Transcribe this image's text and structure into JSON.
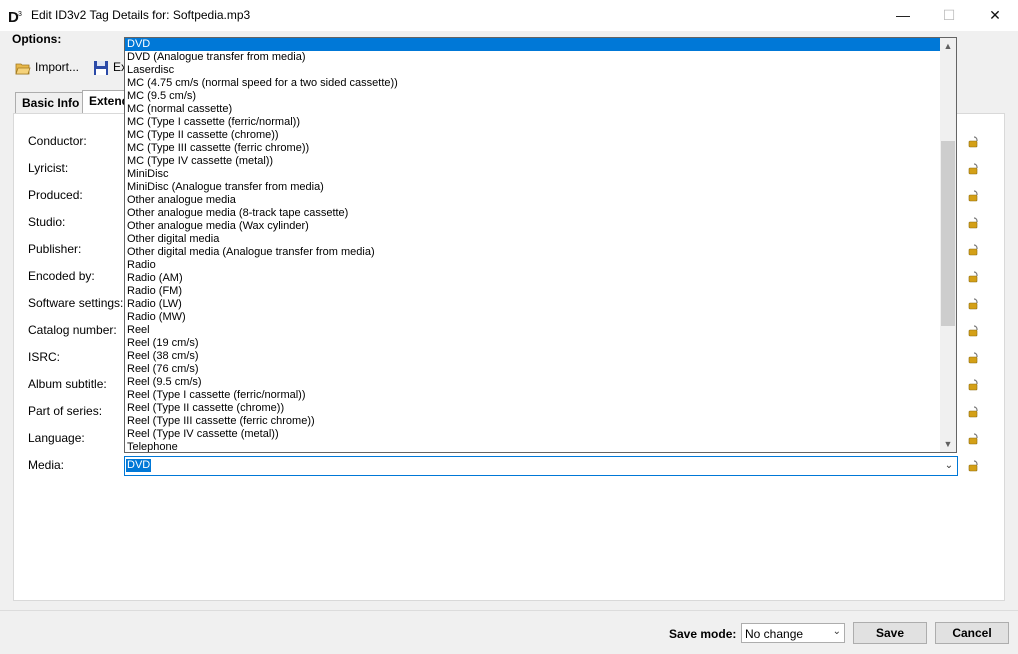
{
  "window": {
    "title": "Edit ID3v2 Tag Details for: Softpedia.mp3",
    "controls": {
      "minimize": "—",
      "maximize": "☐",
      "close": "✕"
    }
  },
  "options_label": "Options:",
  "toolbar": {
    "import_label": "Import...",
    "export_label": "Ex"
  },
  "tabs": [
    {
      "label": "Basic Info",
      "active": false
    },
    {
      "label": "Extende",
      "active": true
    }
  ],
  "fields": [
    "Conductor:",
    "Lyricist:",
    "Produced:",
    "Studio:",
    "Publisher:",
    "Encoded by:",
    "Software settings:",
    "Catalog number:",
    "ISRC:",
    "Album subtitle:",
    "Part of series:",
    "Language:",
    "Media:"
  ],
  "media": {
    "value": "DVD",
    "options": [
      "DVD",
      "DVD (Analogue transfer from media)",
      "Laserdisc",
      "MC (4.75 cm/s (normal speed for a two sided cassette))",
      "MC (9.5 cm/s)",
      "MC (normal cassette)",
      "MC (Type I cassette (ferric/normal))",
      "MC (Type II cassette (chrome))",
      "MC (Type III cassette (ferric chrome))",
      "MC (Type IV cassette (metal))",
      "MiniDisc",
      "MiniDisc (Analogue transfer from media)",
      "Other analogue media",
      "Other analogue media (8-track tape cassette)",
      "Other analogue media (Wax cylinder)",
      "Other digital media",
      "Other digital media (Analogue transfer from media)",
      "Radio",
      "Radio (AM)",
      "Radio (FM)",
      "Radio (LW)",
      "Radio (MW)",
      "Reel",
      "Reel (19 cm/s)",
      "Reel (38 cm/s)",
      "Reel (76 cm/s)",
      "Reel (9.5 cm/s)",
      "Reel (Type I cassette (ferric/normal))",
      "Reel (Type II cassette (chrome))",
      "Reel (Type III cassette (ferric chrome))",
      "Reel (Type IV cassette (metal))",
      "Telephone"
    ],
    "selected_index": 0
  },
  "footer": {
    "save_mode_label": "Save mode:",
    "save_mode_value": "No change",
    "save_label": "Save",
    "cancel_label": "Cancel"
  },
  "colors": {
    "accent": "#0078d7",
    "lock": "#d4a017"
  }
}
